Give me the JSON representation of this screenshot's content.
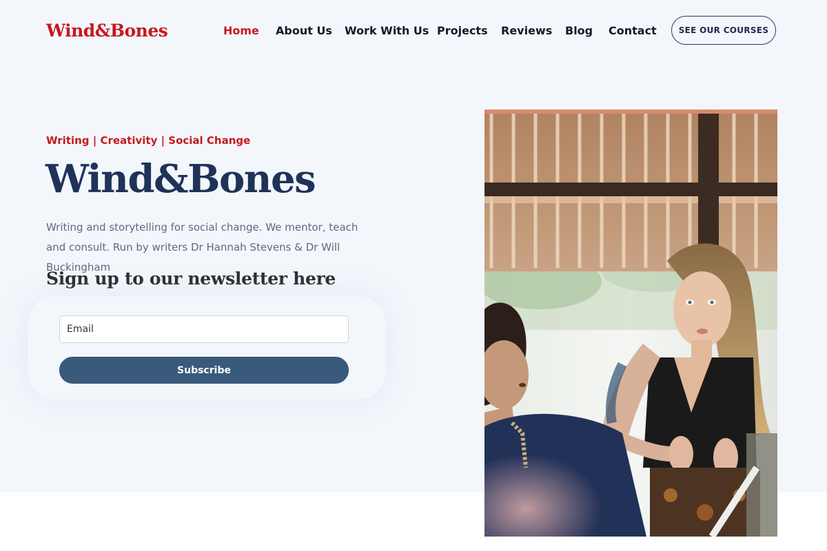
{
  "brand": {
    "name": "Wind&Bones",
    "primary_red": "#c41a1f",
    "navy": "#1f3258",
    "hero_bg": "#f3f6fb"
  },
  "nav": {
    "items": [
      {
        "label": "Home",
        "active": true
      },
      {
        "label": "About Us",
        "active": false
      },
      {
        "label": "Work With Us",
        "active": false
      },
      {
        "label": "Projects",
        "active": false
      },
      {
        "label": "Reviews",
        "active": false
      },
      {
        "label": "Blog",
        "active": false
      },
      {
        "label": "Contact",
        "active": false
      }
    ],
    "cta_label": "SEE OUR COURSES"
  },
  "hero": {
    "tagline": "Writing | Creativity | Social Change",
    "title": "Wind&Bones",
    "description": "Writing and storytelling for social change. We mentor, teach and consult. Run by writers Dr Hannah Stevens & Dr Will Buckingham",
    "newsletter_title": "Sign up to our newsletter here"
  },
  "form": {
    "email_placeholder": "Email",
    "subscribe_label": "Subscribe",
    "button_color": "#3a5a7c"
  },
  "photo": {
    "icon": "workshop-photo"
  }
}
